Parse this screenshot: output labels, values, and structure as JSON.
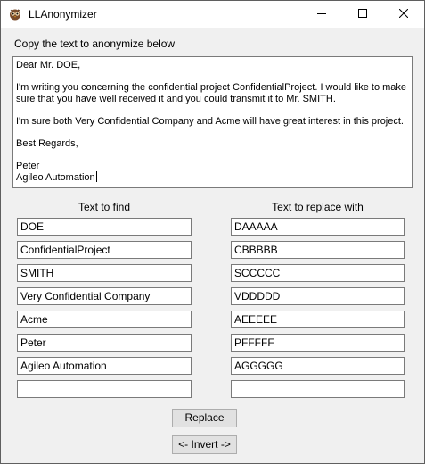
{
  "window": {
    "title": "LLAnonymizer",
    "icon": "owl-app-icon",
    "controls": [
      "minimize-icon",
      "maximize-icon",
      "close-icon"
    ]
  },
  "prompt_label": "Copy the text to anonymize below",
  "text_lines": [
    "Dear Mr. DOE,",
    "",
    "I'm writing you concerning the confidential project ConfidentialProject. I would like to make",
    "sure that you have well received it and you could transmit it to Mr. SMITH.",
    "",
    "I'm sure both Very Confidential Company and Acme will have great interest in this project.",
    "",
    "Best Regards,",
    "",
    "Peter",
    "Agileo Automation"
  ],
  "headers": {
    "find": "Text to find",
    "replace": "Text to replace with"
  },
  "pairs": [
    {
      "find": "DOE",
      "replace": "DAAAAA"
    },
    {
      "find": "ConfidentialProject",
      "replace": "CBBBBB"
    },
    {
      "find": "SMITH",
      "replace": "SCCCCC"
    },
    {
      "find": "Very Confidential Company",
      "replace": "VDDDDD"
    },
    {
      "find": "Acme",
      "replace": "AEEEEE"
    },
    {
      "find": "Peter",
      "replace": "PFFFFF"
    },
    {
      "find": "Agileo Automation",
      "replace": "AGGGGG"
    },
    {
      "find": "",
      "replace": ""
    }
  ],
  "buttons": {
    "replace": "Replace",
    "invert": "<- Invert ->"
  }
}
